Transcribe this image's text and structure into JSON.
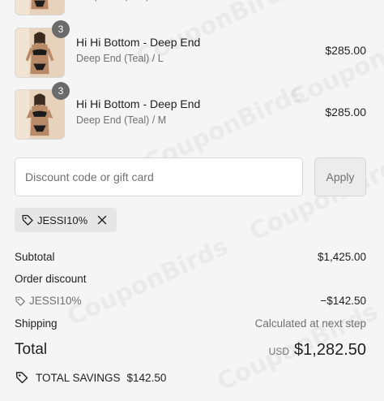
{
  "items": [
    {
      "name": "",
      "variant": "Deep End (Teal) / XL",
      "price": "",
      "quantity": ""
    },
    {
      "name": "Hi Hi Bottom - Deep End",
      "variant": "Deep End (Teal) / L",
      "price": "$285.00",
      "quantity": "3"
    },
    {
      "name": "Hi Hi Bottom - Deep End",
      "variant": "Deep End (Teal) / M",
      "price": "$285.00",
      "quantity": "3"
    }
  ],
  "discount": {
    "placeholder": "Discount code or gift card",
    "apply_label": "Apply",
    "applied_code": "JESSI10%"
  },
  "summary": {
    "subtotal_label": "Subtotal",
    "subtotal_value": "$1,425.00",
    "order_discount_label": "Order discount",
    "discount_code": "JESSI10%",
    "discount_value": "−$142.50",
    "shipping_label": "Shipping",
    "shipping_value": "Calculated at next step",
    "total_label": "Total",
    "currency": "USD",
    "total_value": "$1,282.50",
    "savings_label": "TOTAL SAVINGS",
    "savings_value": "$142.50"
  },
  "watermark": "CouponBirds",
  "colors": {
    "background": "#f5f5f5",
    "badge": "#6b6b6b",
    "muted_text": "#707070",
    "chip": "#e6e6e6"
  }
}
